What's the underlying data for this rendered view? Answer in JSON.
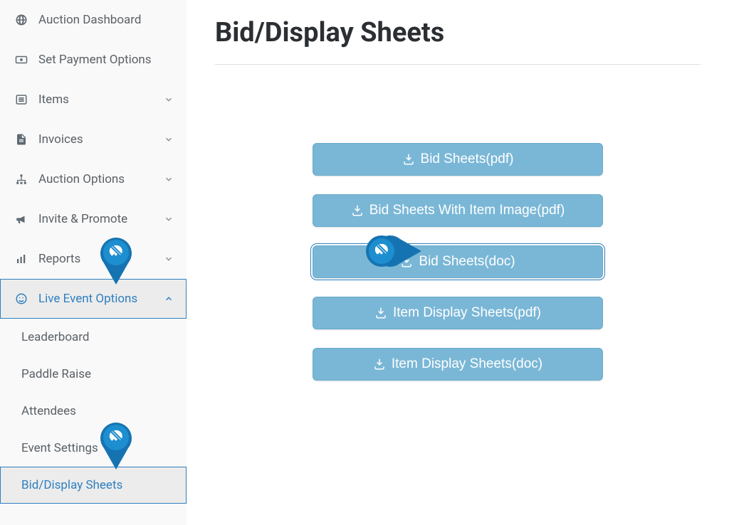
{
  "page": {
    "title": "Bid/Display Sheets"
  },
  "sidebar": {
    "items": [
      {
        "label": "Auction Dashboard"
      },
      {
        "label": "Set Payment Options"
      },
      {
        "label": "Items"
      },
      {
        "label": "Invoices"
      },
      {
        "label": "Auction Options"
      },
      {
        "label": "Invite & Promote"
      },
      {
        "label": "Reports"
      },
      {
        "label": "Live Event Options"
      }
    ],
    "sub": [
      {
        "label": "Leaderboard"
      },
      {
        "label": "Paddle Raise"
      },
      {
        "label": "Attendees"
      },
      {
        "label": "Event Settings"
      },
      {
        "label": "Bid/Display Sheets"
      }
    ]
  },
  "buttons": [
    {
      "label": "Bid Sheets(pdf)"
    },
    {
      "label": "Bid Sheets With Item Image(pdf)"
    },
    {
      "label": "Bid Sheets(doc)"
    },
    {
      "label": "Item Display Sheets(pdf)"
    },
    {
      "label": "Item Display Sheets(doc)"
    }
  ]
}
